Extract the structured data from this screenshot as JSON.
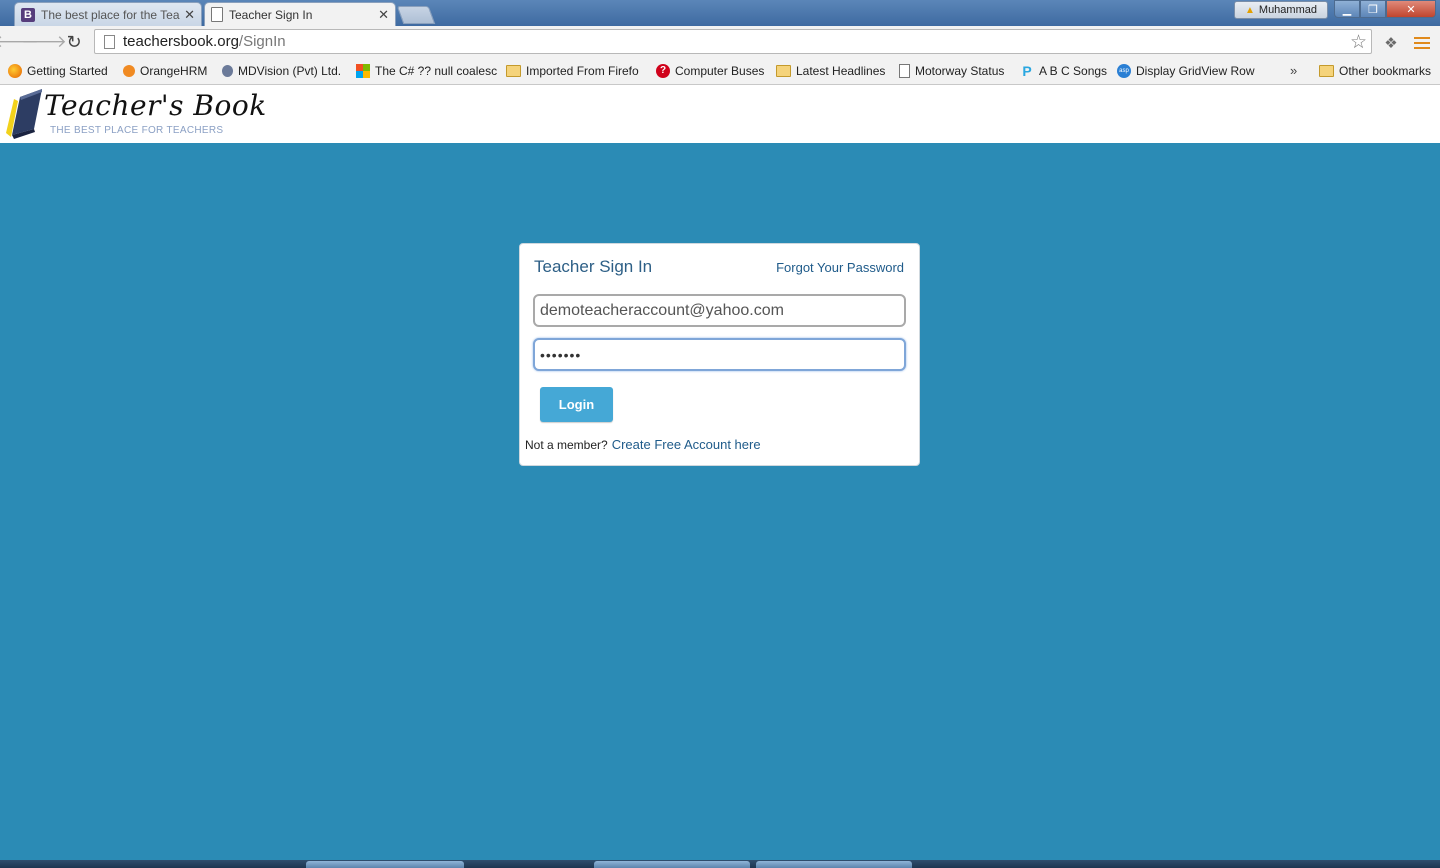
{
  "browser": {
    "tabs": [
      {
        "label": "The best place for the Tea",
        "favicon": "bootstrap-b-icon",
        "favicon_text": "B",
        "active": false
      },
      {
        "label": "Teacher Sign In",
        "favicon": "page-icon",
        "active": true
      }
    ],
    "user_badge": "Muhammad",
    "url_host": "teachersbook.org",
    "url_path": "/SignIn",
    "bookmarks": [
      {
        "label": "Getting Started",
        "icon": "firefox-icon"
      },
      {
        "label": "OrangeHRM",
        "icon": "orange-icon"
      },
      {
        "label": "MDVision (Pvt) Ltd.",
        "icon": "mdvision-icon"
      },
      {
        "label": "The C# ?? null coalesc",
        "icon": "microsoft-icon"
      },
      {
        "label": "Imported From Firefo",
        "icon": "folder-icon"
      },
      {
        "label": "Computer Buses",
        "icon": "question-icon"
      },
      {
        "label": "Latest Headlines",
        "icon": "folder-icon"
      },
      {
        "label": "Motorway Status",
        "icon": "page-icon"
      },
      {
        "label": "A B C Songs",
        "icon": "p-brand-icon"
      },
      {
        "label": "Display GridView Row",
        "icon": "asp-icon"
      }
    ],
    "bookmarks_overflow": "»",
    "other_bookmarks": "Other bookmarks"
  },
  "site": {
    "logo_title": "Teacher's Book",
    "logo_tagline": "THE BEST PLACE FOR TEACHERS"
  },
  "signin": {
    "title": "Teacher Sign In",
    "forgot_link": "Forgot Your Password",
    "email_value": "demoteacheraccount@yahoo.com",
    "password_value": "•••••••",
    "login_button": "Login",
    "not_member": "Not a member?",
    "create_link": "Create Free Account here"
  },
  "colors": {
    "page_background": "#2b8bb5",
    "login_button": "#45a8d6",
    "link": "#1f5b8a"
  }
}
